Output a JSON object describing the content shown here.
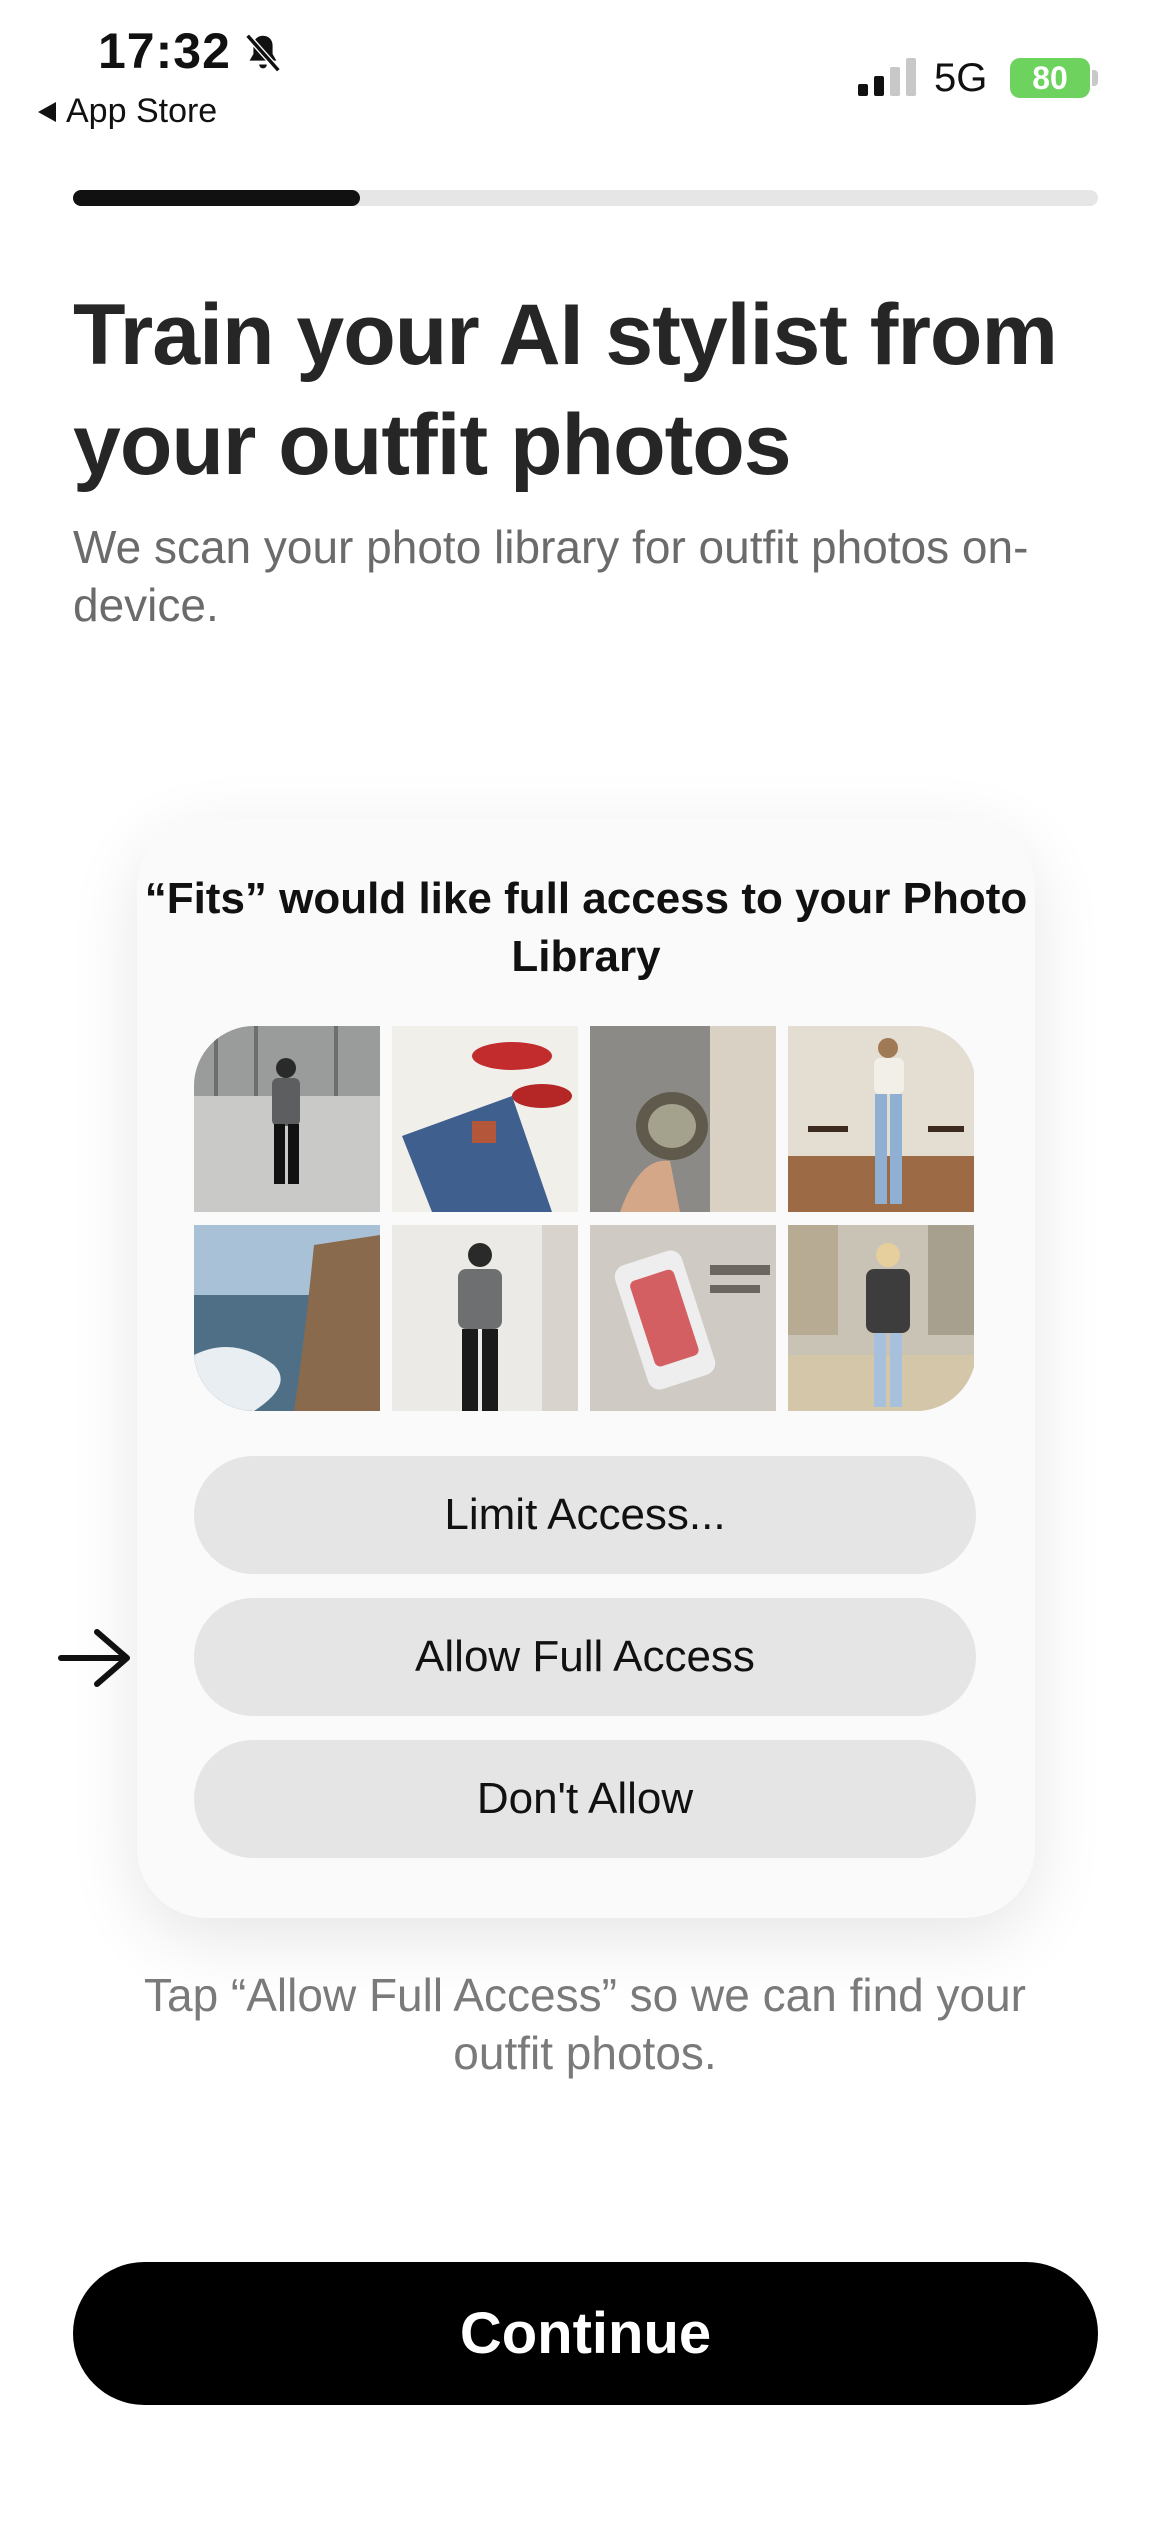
{
  "status_bar": {
    "time": "17:32",
    "back_label": "App Store",
    "network": "5G",
    "battery": "80",
    "icons": [
      "bell-slash-icon",
      "signal-icon",
      "battery-icon"
    ]
  },
  "progress": {
    "fraction": 0.28
  },
  "header": {
    "title": "Train your AI stylist from your outfit photos",
    "subtitle": "We scan your photo library for outfit photos on-device."
  },
  "permission_card": {
    "title": "“Fits” would like full access to your Photo Library",
    "buttons": {
      "limit": "Limit Access...",
      "allow": "Allow Full Access",
      "deny": "Don't Allow"
    }
  },
  "hint": "Tap “Allow Full Access” so we can find your outfit photos.",
  "continue_label": "Continue",
  "colors": {
    "accent": "#000000",
    "battery": "#6dd35e",
    "button_gray": "#e5e5e5",
    "text_secondary": "#6b6b6b"
  }
}
